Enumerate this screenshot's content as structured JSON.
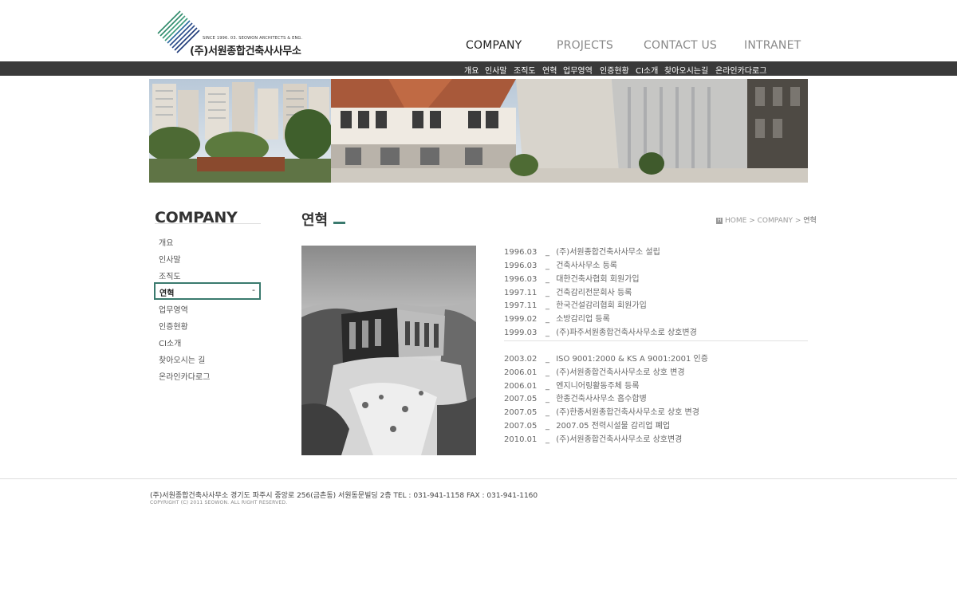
{
  "header": {
    "logo": {
      "since": "SINCE 1996. 03. SEOWON ARCHITECTS & ENG.",
      "name": "(주)서원종합건축사사무소"
    },
    "main_nav": [
      {
        "label": "COMPANY",
        "active": true
      },
      {
        "label": "PROJECTS",
        "active": false
      },
      {
        "label": "CONTACT US",
        "active": false
      },
      {
        "label": "INTRANET",
        "active": false
      }
    ],
    "sub_nav": [
      "개요",
      "인사말",
      "조직도",
      "연혁",
      "업무영역",
      "인증현황",
      "CI소개",
      "찾아오시는길",
      "온라인카다로그"
    ]
  },
  "sidebar": {
    "title": "COMPANY",
    "items": [
      "개요",
      "인사말",
      "조직도",
      "연혁",
      "업무영역",
      "인증현황",
      "CI소개",
      "찾아오시는 길",
      "온라인카다로그"
    ],
    "active_index": 3,
    "active_marker": "-"
  },
  "content": {
    "title": "연혁",
    "breadcrumb": {
      "home": "HOME",
      "sep": ">",
      "section": "COMPANY",
      "current": "연혁"
    },
    "history_group1": [
      {
        "date": "1996.03",
        "text": "(주)서원종합건축사사무소 설립"
      },
      {
        "date": "1996.03",
        "text": "건축사사무소 등록"
      },
      {
        "date": "1996.03",
        "text": "대한건축사협회 회원가입"
      },
      {
        "date": "1997.11",
        "text": "건축감리전문회사 등록"
      },
      {
        "date": "1997.11",
        "text": "한국건설감리협회 회원가입"
      },
      {
        "date": "1999.02",
        "text": "소방감리업 등록"
      },
      {
        "date": "1999.03",
        "text": "(주)파주서원종합건축사사무소로 상호변경"
      }
    ],
    "history_group2": [
      {
        "date": "2003.02",
        "text": "ISO 9001:2000 & KS A 9001:2001 인증"
      },
      {
        "date": "2006.01",
        "text": "(주)서원종합건축사사무소로 상호 변경"
      },
      {
        "date": "2006.01",
        "text": "엔지니어링활동주체 등록"
      },
      {
        "date": "2007.05",
        "text": "한종건축사사무소 흡수합병"
      },
      {
        "date": "2007.05",
        "text": "(주)한종서원종합건축사사무소로 상호 변경"
      },
      {
        "date": "2007.05",
        "text": "2007.05 전력시설물 감리업 폐업"
      },
      {
        "date": "2010.01",
        "text": "(주)서원종합건축사사무소로 상호변경"
      }
    ],
    "dash": "_"
  },
  "footer": {
    "address": "(주)서원종합건축사사무소 경기도 파주시 중앙로 256(금촌동) 서원동문빌딩 2층   TEL : 031-941-1158   FAX : 031-941-1160",
    "copyright": "COPYRIGHT (C) 2011 SEOWON. ALL RIGHT RESERVED."
  },
  "colors": {
    "accent": "#3a7a6e",
    "subbar": "#3a3a3a",
    "logo_blue": "#2a4a8a",
    "logo_green": "#2f8a6a"
  }
}
